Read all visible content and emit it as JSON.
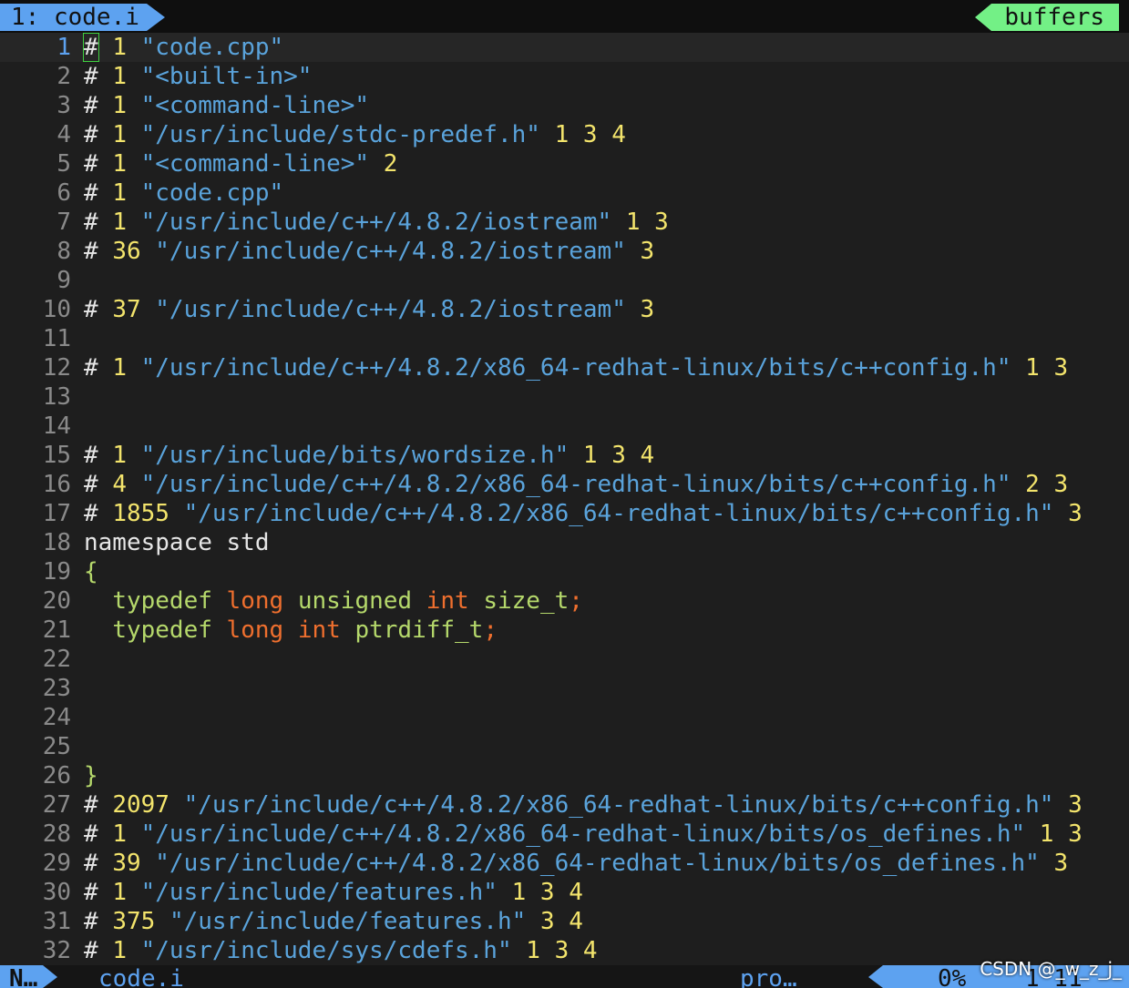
{
  "tabline": {
    "active_tab": "1: code.i",
    "right_label": "buffers"
  },
  "lines": [
    {
      "n": "1",
      "segs": [
        [
          "hash",
          "#"
        ],
        [
          "plain",
          " "
        ],
        [
          "num",
          "1"
        ],
        [
          "plain",
          " "
        ],
        [
          "str",
          "\"code.cpp\""
        ]
      ]
    },
    {
      "n": "2",
      "segs": [
        [
          "hash",
          "#"
        ],
        [
          "plain",
          " "
        ],
        [
          "num",
          "1"
        ],
        [
          "plain",
          " "
        ],
        [
          "str",
          "\"<built-in>\""
        ]
      ]
    },
    {
      "n": "3",
      "segs": [
        [
          "hash",
          "#"
        ],
        [
          "plain",
          " "
        ],
        [
          "num",
          "1"
        ],
        [
          "plain",
          " "
        ],
        [
          "str",
          "\"<command-line>\""
        ]
      ]
    },
    {
      "n": "4",
      "segs": [
        [
          "hash",
          "#"
        ],
        [
          "plain",
          " "
        ],
        [
          "num",
          "1"
        ],
        [
          "plain",
          " "
        ],
        [
          "str",
          "\"/usr/include/stdc-predef.h\""
        ],
        [
          "plain",
          " "
        ],
        [
          "num",
          "1 3 4"
        ]
      ]
    },
    {
      "n": "5",
      "segs": [
        [
          "hash",
          "#"
        ],
        [
          "plain",
          " "
        ],
        [
          "num",
          "1"
        ],
        [
          "plain",
          " "
        ],
        [
          "str",
          "\"<command-line>\""
        ],
        [
          "plain",
          " "
        ],
        [
          "num",
          "2"
        ]
      ]
    },
    {
      "n": "6",
      "segs": [
        [
          "hash",
          "#"
        ],
        [
          "plain",
          " "
        ],
        [
          "num",
          "1"
        ],
        [
          "plain",
          " "
        ],
        [
          "str",
          "\"code.cpp\""
        ]
      ]
    },
    {
      "n": "7",
      "segs": [
        [
          "hash",
          "#"
        ],
        [
          "plain",
          " "
        ],
        [
          "num",
          "1"
        ],
        [
          "plain",
          " "
        ],
        [
          "str",
          "\"/usr/include/c++/4.8.2/iostream\""
        ],
        [
          "plain",
          " "
        ],
        [
          "num",
          "1 3"
        ]
      ]
    },
    {
      "n": "8",
      "segs": [
        [
          "hash",
          "#"
        ],
        [
          "plain",
          " "
        ],
        [
          "num",
          "36"
        ],
        [
          "plain",
          " "
        ],
        [
          "str",
          "\"/usr/include/c++/4.8.2/iostream\""
        ],
        [
          "plain",
          " "
        ],
        [
          "num",
          "3"
        ]
      ]
    },
    {
      "n": "9",
      "segs": []
    },
    {
      "n": "10",
      "segs": [
        [
          "hash",
          "#"
        ],
        [
          "plain",
          " "
        ],
        [
          "num",
          "37"
        ],
        [
          "plain",
          " "
        ],
        [
          "str",
          "\"/usr/include/c++/4.8.2/iostream\""
        ],
        [
          "plain",
          " "
        ],
        [
          "num",
          "3"
        ]
      ]
    },
    {
      "n": "11",
      "segs": []
    },
    {
      "n": "12",
      "segs": [
        [
          "hash",
          "#"
        ],
        [
          "plain",
          " "
        ],
        [
          "num",
          "1"
        ],
        [
          "plain",
          " "
        ],
        [
          "str",
          "\"/usr/include/c++/4.8.2/x86_64-redhat-linux/bits/c++config.h\""
        ],
        [
          "plain",
          " "
        ],
        [
          "num",
          "1 3"
        ]
      ]
    },
    {
      "n": "13",
      "segs": []
    },
    {
      "n": "14",
      "segs": []
    },
    {
      "n": "15",
      "segs": [
        [
          "hash",
          "#"
        ],
        [
          "plain",
          " "
        ],
        [
          "num",
          "1"
        ],
        [
          "plain",
          " "
        ],
        [
          "str",
          "\"/usr/include/bits/wordsize.h\""
        ],
        [
          "plain",
          " "
        ],
        [
          "num",
          "1 3 4"
        ]
      ]
    },
    {
      "n": "16",
      "segs": [
        [
          "hash",
          "#"
        ],
        [
          "plain",
          " "
        ],
        [
          "num",
          "4"
        ],
        [
          "plain",
          " "
        ],
        [
          "str",
          "\"/usr/include/c++/4.8.2/x86_64-redhat-linux/bits/c++config.h\""
        ],
        [
          "plain",
          " "
        ],
        [
          "num",
          "2 3"
        ]
      ]
    },
    {
      "n": "17",
      "segs": [
        [
          "hash",
          "#"
        ],
        [
          "plain",
          " "
        ],
        [
          "num",
          "1855"
        ],
        [
          "plain",
          " "
        ],
        [
          "str",
          "\"/usr/include/c++/4.8.2/x86_64-redhat-linux/bits/c++config.h\""
        ],
        [
          "plain",
          " "
        ],
        [
          "num",
          "3"
        ]
      ]
    },
    {
      "n": "18",
      "segs": [
        [
          "plain",
          "namespace std"
        ]
      ]
    },
    {
      "n": "19",
      "segs": [
        [
          "kw",
          "{"
        ]
      ]
    },
    {
      "n": "20",
      "segs": [
        [
          "plain",
          "  "
        ],
        [
          "kw",
          "typedef"
        ],
        [
          "plain",
          " "
        ],
        [
          "type",
          "long"
        ],
        [
          "plain",
          " "
        ],
        [
          "kw",
          "unsigned"
        ],
        [
          "plain",
          " "
        ],
        [
          "type",
          "int"
        ],
        [
          "plain",
          " "
        ],
        [
          "kw",
          "size_t"
        ],
        [
          "type",
          ";"
        ]
      ]
    },
    {
      "n": "21",
      "segs": [
        [
          "plain",
          "  "
        ],
        [
          "kw",
          "typedef"
        ],
        [
          "plain",
          " "
        ],
        [
          "type",
          "long"
        ],
        [
          "plain",
          " "
        ],
        [
          "type",
          "int"
        ],
        [
          "plain",
          " "
        ],
        [
          "kw",
          "ptrdiff_t"
        ],
        [
          "type",
          ";"
        ]
      ]
    },
    {
      "n": "22",
      "segs": []
    },
    {
      "n": "23",
      "segs": []
    },
    {
      "n": "24",
      "segs": []
    },
    {
      "n": "25",
      "segs": []
    },
    {
      "n": "26",
      "segs": [
        [
          "kw",
          "}"
        ]
      ]
    },
    {
      "n": "27",
      "segs": [
        [
          "hash",
          "#"
        ],
        [
          "plain",
          " "
        ],
        [
          "num",
          "2097"
        ],
        [
          "plain",
          " "
        ],
        [
          "str",
          "\"/usr/include/c++/4.8.2/x86_64-redhat-linux/bits/c++config.h\""
        ],
        [
          "plain",
          " "
        ],
        [
          "num",
          "3"
        ]
      ]
    },
    {
      "n": "28",
      "segs": [
        [
          "hash",
          "#"
        ],
        [
          "plain",
          " "
        ],
        [
          "num",
          "1"
        ],
        [
          "plain",
          " "
        ],
        [
          "str",
          "\"/usr/include/c++/4.8.2/x86_64-redhat-linux/bits/os_defines.h\""
        ],
        [
          "plain",
          " "
        ],
        [
          "num",
          "1 3"
        ]
      ]
    },
    {
      "n": "29",
      "segs": [
        [
          "hash",
          "#"
        ],
        [
          "plain",
          " "
        ],
        [
          "num",
          "39"
        ],
        [
          "plain",
          " "
        ],
        [
          "str",
          "\"/usr/include/c++/4.8.2/x86_64-redhat-linux/bits/os_defines.h\""
        ],
        [
          "plain",
          " "
        ],
        [
          "num",
          "3"
        ]
      ]
    },
    {
      "n": "30",
      "segs": [
        [
          "hash",
          "#"
        ],
        [
          "plain",
          " "
        ],
        [
          "num",
          "1"
        ],
        [
          "plain",
          " "
        ],
        [
          "str",
          "\"/usr/include/features.h\""
        ],
        [
          "plain",
          " "
        ],
        [
          "num",
          "1 3 4"
        ]
      ]
    },
    {
      "n": "31",
      "segs": [
        [
          "hash",
          "#"
        ],
        [
          "plain",
          " "
        ],
        [
          "num",
          "375"
        ],
        [
          "plain",
          " "
        ],
        [
          "str",
          "\"/usr/include/features.h\""
        ],
        [
          "plain",
          " "
        ],
        [
          "num",
          "3 4"
        ]
      ]
    },
    {
      "n": "32",
      "segs": [
        [
          "hash",
          "#"
        ],
        [
          "plain",
          " "
        ],
        [
          "num",
          "1"
        ],
        [
          "plain",
          " "
        ],
        [
          "str",
          "\"/usr/include/sys/cdefs.h\""
        ],
        [
          "plain",
          " "
        ],
        [
          "num",
          "1 3 4"
        ]
      ]
    }
  ],
  "statusline": {
    "mode": "N…",
    "file": "code.i",
    "filetype": "pro…",
    "percent": "0%",
    "position": "1 11"
  },
  "watermark": "CSDN @_w_z_j_",
  "colors": {
    "accent_blue": "#5da2f0",
    "accent_green": "#73f086",
    "string": "#5aa3db",
    "number": "#f3e46c",
    "keyword": "#b5d86b",
    "type": "#ef6f2e",
    "background": "#1e1e1e"
  }
}
